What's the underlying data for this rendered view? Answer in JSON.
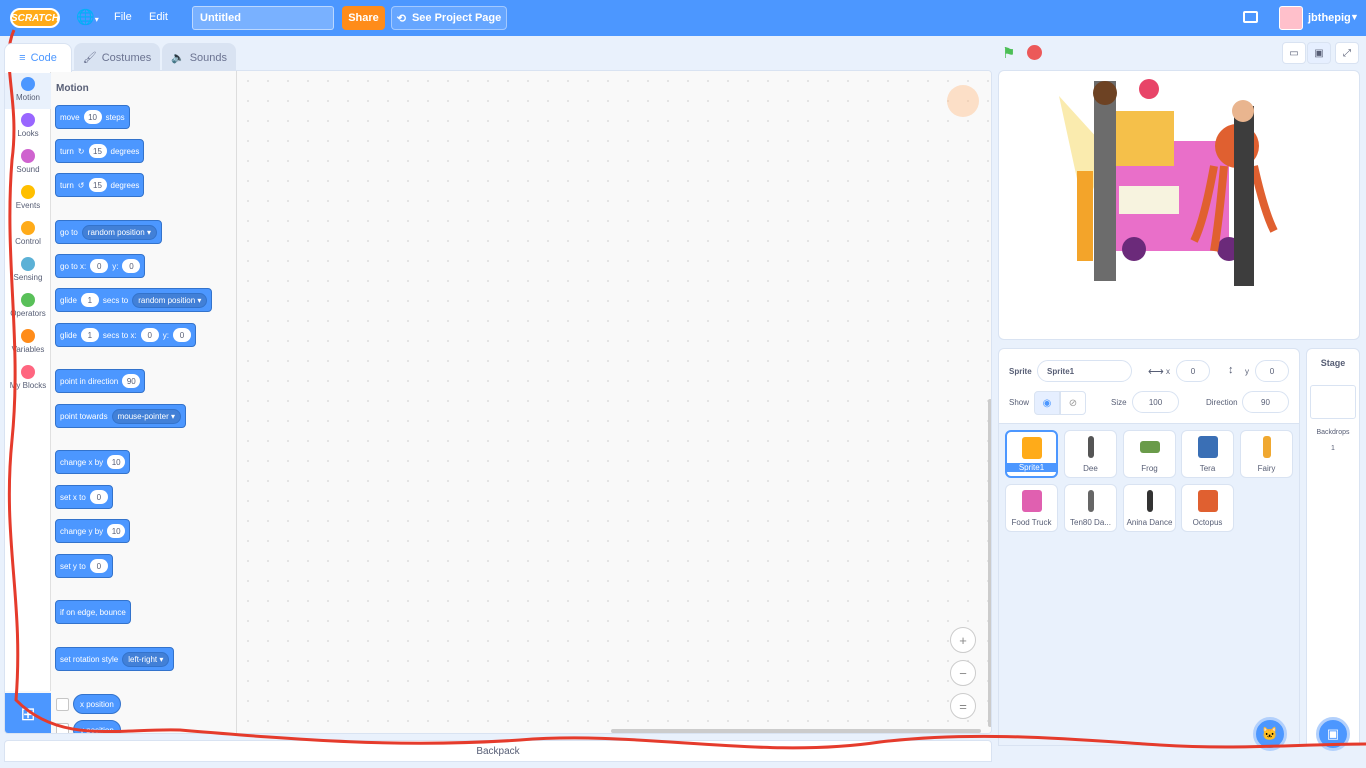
{
  "menubar": {
    "logo_text": "SCRATCH",
    "file_label": "File",
    "edit_label": "Edit",
    "project_title": "Untitled",
    "share_label": "Share",
    "see_project_label": "See Project Page",
    "username": "jbthepig"
  },
  "tabs": {
    "code": "Code",
    "costumes": "Costumes",
    "sounds": "Sounds"
  },
  "categories": [
    {
      "label": "Motion",
      "color": "#4c97ff"
    },
    {
      "label": "Looks",
      "color": "#9966ff"
    },
    {
      "label": "Sound",
      "color": "#cf63cf"
    },
    {
      "label": "Events",
      "color": "#ffbf00"
    },
    {
      "label": "Control",
      "color": "#ffab19"
    },
    {
      "label": "Sensing",
      "color": "#5cb1d6"
    },
    {
      "label": "Operators",
      "color": "#59c059"
    },
    {
      "label": "Variables",
      "color": "#ff8c1a"
    },
    {
      "label": "My Blocks",
      "color": "#ff6680"
    }
  ],
  "palette": {
    "title": "Motion",
    "move": {
      "pre": "move",
      "val": "10",
      "post": "steps"
    },
    "turn_right": {
      "pre": "turn",
      "val": "15",
      "post": "degrees"
    },
    "turn_left": {
      "pre": "turn",
      "val": "15",
      "post": "degrees"
    },
    "goto": {
      "pre": "go to",
      "drop": "random position"
    },
    "goto_xy": {
      "pre": "go to x:",
      "x": "0",
      "mid": "y:",
      "y": "0"
    },
    "glide_to": {
      "pre": "glide",
      "val": "1",
      "mid": "secs to",
      "drop": "random position"
    },
    "glide_xy": {
      "pre": "glide",
      "val": "1",
      "mid": "secs to x:",
      "x": "0",
      "mid2": "y:",
      "y": "0"
    },
    "point_dir": {
      "pre": "point in direction",
      "val": "90"
    },
    "point_towards": {
      "pre": "point towards",
      "drop": "mouse-pointer"
    },
    "change_x": {
      "pre": "change x by",
      "val": "10"
    },
    "set_x": {
      "pre": "set x to",
      "val": "0"
    },
    "change_y": {
      "pre": "change y by",
      "val": "10"
    },
    "set_y": {
      "pre": "set y to",
      "val": "0"
    },
    "bounce": "if on edge, bounce",
    "rotation": {
      "pre": "set rotation style",
      "drop": "left-right"
    },
    "x_position": "x position",
    "y_position": "y position"
  },
  "workspace": {
    "zoom_in": "+",
    "zoom_out": "−",
    "zoom_reset": "="
  },
  "backpack_label": "Backpack",
  "sprite_info": {
    "sprite_label": "Sprite",
    "sprite_name": "Sprite1",
    "x_label": "x",
    "x_value": "0",
    "y_label": "y",
    "y_value": "0",
    "show_label": "Show",
    "size_label": "Size",
    "size_value": "100",
    "direction_label": "Direction",
    "direction_value": "90"
  },
  "sprites": [
    {
      "name": "Sprite1",
      "color": "#ffab19"
    },
    {
      "name": "Dee",
      "color": "#555"
    },
    {
      "name": "Frog",
      "color": "#6a9b4a"
    },
    {
      "name": "Tera",
      "color": "#3a6fb5"
    },
    {
      "name": "Fairy",
      "color": "#f0a830"
    },
    {
      "name": "Food Truck",
      "color": "#e060b0"
    },
    {
      "name": "Ten80 Da...",
      "color": "#666"
    },
    {
      "name": "Anina Dance",
      "color": "#333"
    },
    {
      "name": "Octopus",
      "color": "#e06030"
    }
  ],
  "stage_panel": {
    "title": "Stage",
    "backdrops_label": "Backdrops",
    "backdrops_count": "1"
  },
  "icons": {
    "flag": "green-flag-icon",
    "stop": "stop-icon",
    "globe": "globe-icon",
    "folder": "folder-icon"
  }
}
